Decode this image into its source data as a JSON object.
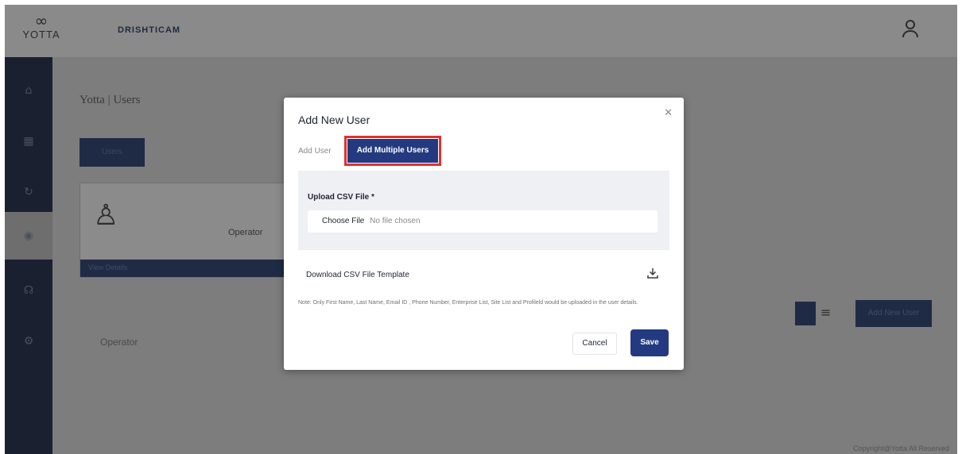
{
  "app": {
    "logo_word": "YOTTA",
    "brand": "DRISHTICAM"
  },
  "background": {
    "page_title": "Yotta | Users",
    "primary_button": "Users",
    "card_view_details": "View Details",
    "card_role": "Operator",
    "operator_tab": "Operator",
    "add_new_user_button": "Add New User",
    "footer": "Copyright@Yotta All Reserved"
  },
  "modal": {
    "title": "Add New User",
    "tabs": [
      {
        "label": "Add User"
      },
      {
        "label": "Add Multiple Users"
      }
    ],
    "upload_label": "Upload CSV File *",
    "choose_file_label": "Choose File",
    "no_file_text": "No file chosen",
    "download_label": "Download CSV File Template",
    "note": "Note: Only First Name, Last Name, Email ID , Phone Number, Enterprise List, Site List and Profileld would be uploaded in the user details.",
    "cancel_label": "Cancel",
    "save_label": "Save"
  },
  "colors": {
    "accent": "#243a80",
    "highlight": "#e03030",
    "sidebar": "#1a2030"
  },
  "icons": {
    "close": "close-icon",
    "download": "download-icon",
    "user": "user-icon"
  }
}
